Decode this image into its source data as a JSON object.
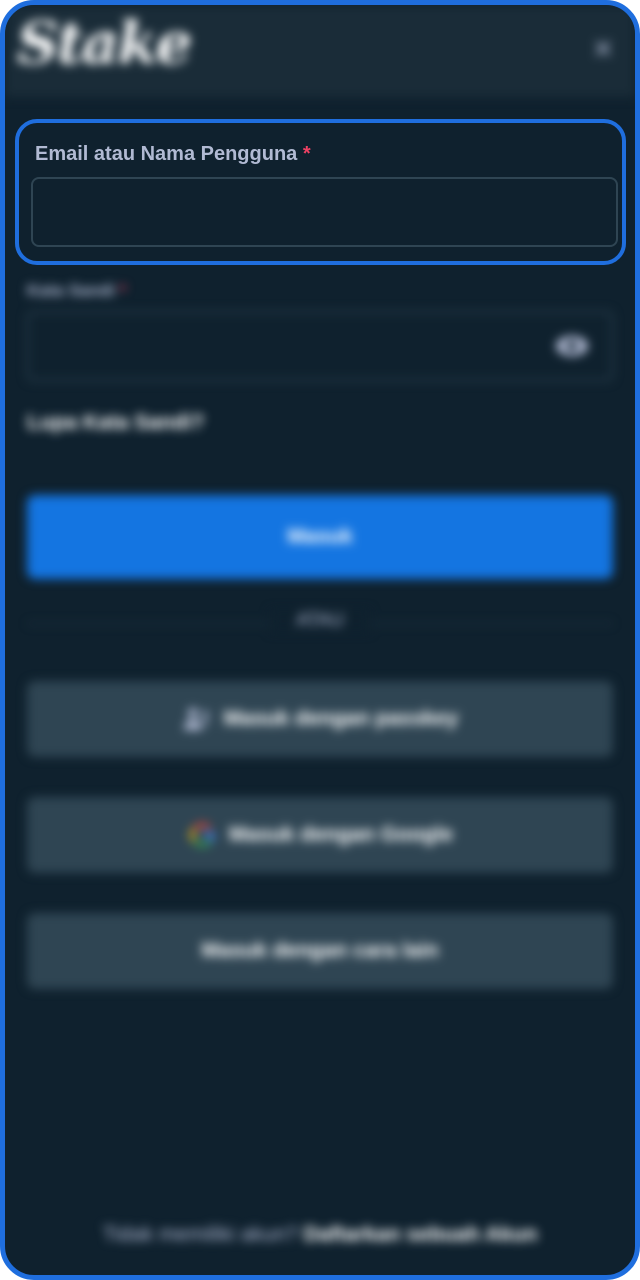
{
  "header": {
    "logo_text": "Stake",
    "close_icon": "×"
  },
  "email_field": {
    "label": "Email atau Nama Pengguna",
    "required_mark": "*",
    "value": "",
    "placeholder": ""
  },
  "password_field": {
    "label": "Kata Sandi",
    "required_mark": "*",
    "value": "",
    "placeholder": "",
    "toggle_icon": "eye-icon"
  },
  "forgot_password": "Lupa Kata Sandi?",
  "buttons": {
    "login": "Masuk",
    "passkey": "Masuk dengan passkey",
    "google": "Masuk dengan Google",
    "other": "Masuk dengan cara lain"
  },
  "divider_text": "ATAU",
  "footer": {
    "prompt": "Tidak memiliki akun?",
    "register_link": "Daftarkan sebuah Akun"
  },
  "colors": {
    "background": "#0f212e",
    "header": "#1a2c38",
    "primary": "#1475e1",
    "secondary": "#2f4553",
    "highlight_border": "#1f6ede",
    "required": "#ed4163"
  }
}
